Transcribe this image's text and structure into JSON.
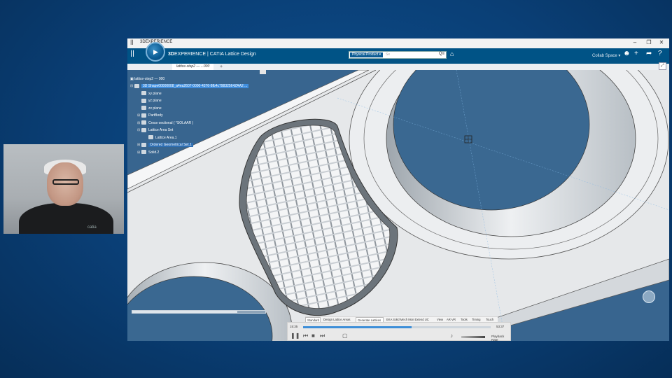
{
  "window": {
    "title": "3DEXPERIENCE",
    "controls": [
      "–",
      "❐",
      "✕"
    ]
  },
  "topbar": {
    "brand_bold": "3D",
    "brand_rest": "EXPERIENCE | CATIA Lattice Design",
    "search_scope": "Physical Product ▾",
    "search_placeholder": "Se",
    "search_icon": "Q≡",
    "collab_space": "Collab Space ▾",
    "icons": [
      "user-add-icon",
      "plus-icon",
      "share-icon",
      "help-icon"
    ]
  },
  "doc_tab": {
    "label": "lattice-step2 — ...000",
    "plus": "+"
  },
  "tree": {
    "root": "lattice-step2 — 000",
    "items": [
      {
        "label": "3D Shape00000008_a4ea2607-0000-4376-8fb4c79832564ZAA2 ...",
        "selected": true,
        "indent": 0,
        "exp": "⊟"
      },
      {
        "label": "xy plane",
        "selected": false,
        "indent": 1,
        "exp": ""
      },
      {
        "label": "yz plane",
        "selected": false,
        "indent": 1,
        "exp": ""
      },
      {
        "label": "zx plane",
        "selected": false,
        "indent": 1,
        "exp": ""
      },
      {
        "label": "PartBody",
        "selected": false,
        "indent": 1,
        "exp": "⊞"
      },
      {
        "label": "Cross-sectional ( *SOLAAR )",
        "selected": false,
        "indent": 1,
        "exp": "⊞"
      },
      {
        "label": "Lattice Area Set",
        "selected": false,
        "indent": 1,
        "exp": "⊟"
      },
      {
        "label": "Lattice Area.1",
        "selected": false,
        "indent": 2,
        "exp": ""
      },
      {
        "label": "Ordered Geometrical Set.1",
        "selected": false,
        "indent": 1,
        "exp": "⊞"
      },
      {
        "label": "Solid.2",
        "selected": false,
        "indent": 1,
        "exp": "⊞"
      }
    ]
  },
  "action_tabs": [
    "Standard",
    "Design Lattice Areas",
    "Generate Lattices",
    "EKA Solid Mech Mon Extend UC",
    "View",
    "AR-VR",
    "Tools",
    "Timing",
    "Touch"
  ],
  "player": {
    "elapsed": "15:35",
    "remaining": "53:37",
    "progress": 0.58,
    "speed": "Playback Rate"
  },
  "webcam": {
    "logo_text": "catia"
  }
}
